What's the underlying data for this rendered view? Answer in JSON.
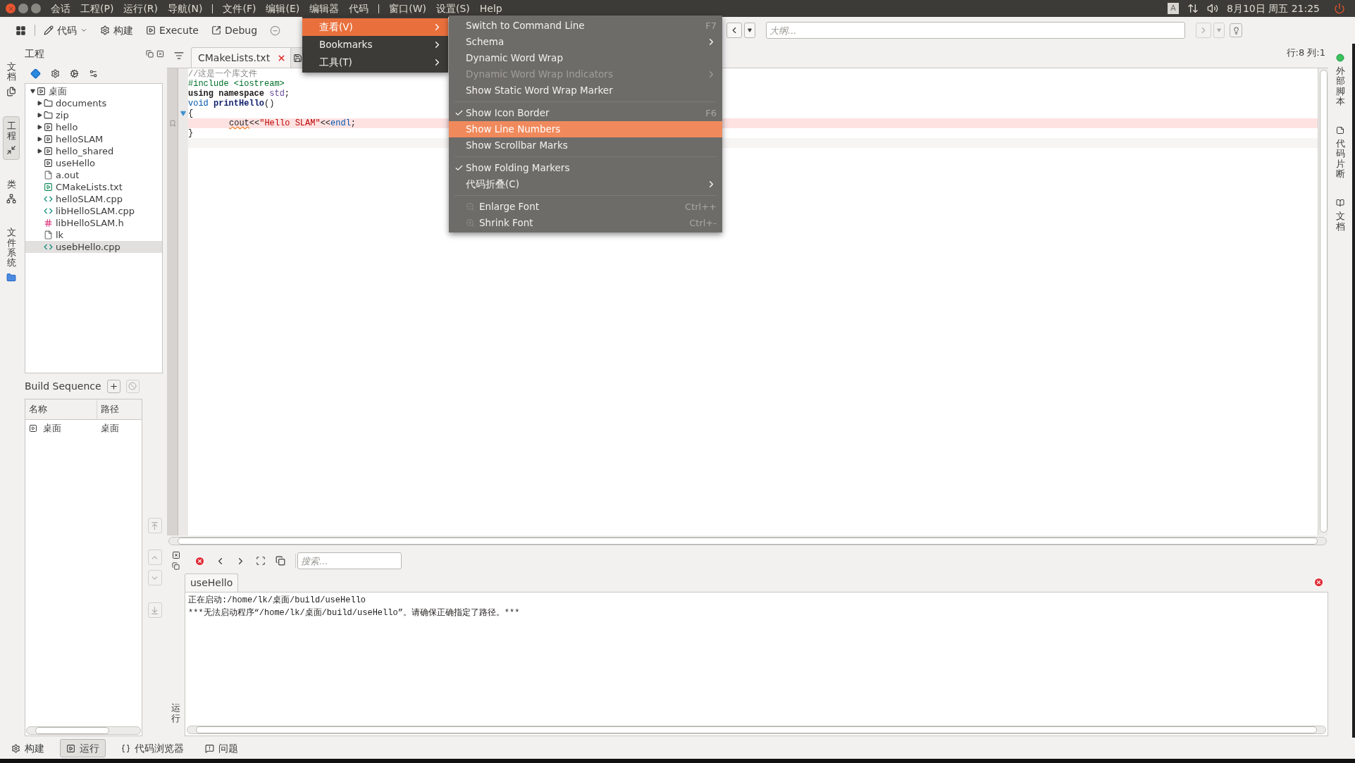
{
  "menubar": {
    "items": [
      {
        "kind": "menu",
        "label": "会话"
      },
      {
        "kind": "menu",
        "label": "工程(P)"
      },
      {
        "kind": "menu",
        "label": "运行(R)"
      },
      {
        "kind": "menu",
        "label": "导航(N)"
      },
      {
        "kind": "separator"
      },
      {
        "kind": "menu",
        "label": "文件(F)"
      },
      {
        "kind": "menu",
        "label": "编辑(E)"
      },
      {
        "kind": "menu",
        "label": "编辑器"
      },
      {
        "kind": "menu",
        "label": "代码"
      },
      {
        "kind": "separator"
      },
      {
        "kind": "menu",
        "label": "窗口(W)"
      },
      {
        "kind": "menu",
        "label": "设置(S)"
      },
      {
        "kind": "menu",
        "label": "Help"
      }
    ]
  },
  "tray": {
    "keyboard": "A",
    "clock": "8月10日 周五 21:25"
  },
  "toolbar": {
    "items": [
      {
        "label": "代码",
        "dropdown": true
      },
      {
        "label": "构建",
        "dropdown": false
      },
      {
        "label": "Execute",
        "dropdown": false
      },
      {
        "label": "Debug",
        "dropdown": false
      }
    ],
    "outline_placeholder": "大纲..."
  },
  "cursor_position": "行:8 列:1",
  "editor_tabs": [
    {
      "kind": "tab",
      "label": "CMakeLists.txt",
      "selected": true
    },
    {
      "kind": "covered",
      "selected": false
    }
  ],
  "code": [
    {
      "indented": false,
      "marked": false,
      "current": false,
      "fold_marker": false,
      "tokens": [
        {
          "kind": "comment",
          "text": "//这是一个库文件"
        }
      ]
    },
    {
      "indented": false,
      "marked": false,
      "current": false,
      "fold_marker": false,
      "tokens": [
        {
          "kind": "preprocessor",
          "text": "#include <iostream>"
        }
      ]
    },
    {
      "indented": false,
      "marked": false,
      "current": false,
      "fold_marker": false,
      "tokens": [
        {
          "kind": "keyword",
          "text": "using namespace"
        },
        {
          "kind": "namespace",
          "text": " std"
        },
        {
          "kind": "plain",
          "text": ";"
        }
      ]
    },
    {
      "indented": false,
      "marked": false,
      "current": false,
      "fold_marker": false,
      "tokens": [
        {
          "kind": "type",
          "text": "void "
        },
        {
          "kind": "function",
          "text": "printHello"
        },
        {
          "kind": "plain",
          "text": "()"
        }
      ]
    },
    {
      "indented": false,
      "marked": false,
      "current": false,
      "fold_marker": true,
      "tokens": [
        {
          "kind": "plain",
          "text": "{"
        }
      ]
    },
    {
      "indented": true,
      "marked": true,
      "current": false,
      "fold_marker": false,
      "tokens": [
        {
          "kind": "warning",
          "text": "cout"
        },
        {
          "kind": "plain",
          "text": "<<"
        },
        {
          "kind": "string",
          "text": "\"Hello SLAM\""
        },
        {
          "kind": "plain",
          "text": "<<"
        },
        {
          "kind": "type",
          "text": "endl"
        },
        {
          "kind": "plain",
          "text": ";"
        }
      ]
    },
    {
      "indented": false,
      "marked": false,
      "current": false,
      "fold_marker": false,
      "tokens": [
        {
          "kind": "plain",
          "text": "}"
        }
      ]
    },
    {
      "indented": false,
      "marked": false,
      "current": true,
      "fold_marker": false
    }
  ],
  "left_dock_tabs": [
    {
      "label": "文档",
      "selected": false
    },
    {
      "label": "工程",
      "selected": true
    },
    {
      "label": "类",
      "selected": false
    },
    {
      "label": "文件系统",
      "selected": false
    }
  ],
  "right_dock_tabs": [
    {
      "label": "外部脚本"
    },
    {
      "label": "代码片断"
    },
    {
      "label": "文档"
    }
  ],
  "project_panel": {
    "title": "工程",
    "tree": [
      {
        "label": "桌面",
        "kind": "target",
        "expanded": true,
        "selected": false,
        "children": [
          {
            "label": "documents",
            "kind": "folder",
            "expanded": false,
            "selected": false
          },
          {
            "label": "zip",
            "kind": "folder",
            "expanded": false,
            "selected": false
          },
          {
            "label": "hello",
            "kind": "target",
            "expanded": false,
            "selected": false
          },
          {
            "label": "helloSLAM",
            "kind": "target",
            "expanded": false,
            "selected": false
          },
          {
            "label": "hello_shared",
            "kind": "target",
            "expanded": false,
            "selected": false
          },
          {
            "label": "useHello",
            "kind": "target",
            "selected": false
          },
          {
            "label": "a.out",
            "kind": "unknown",
            "selected": false
          },
          {
            "label": "CMakeLists.txt",
            "kind": "cmake",
            "selected": false
          },
          {
            "label": "helloSLAM.cpp",
            "kind": "source",
            "selected": false
          },
          {
            "label": "libHelloSLAM.cpp",
            "kind": "source",
            "selected": false
          },
          {
            "label": "libHelloSLAM.h",
            "kind": "header",
            "selected": false
          },
          {
            "label": "lk",
            "kind": "unknown",
            "selected": false
          },
          {
            "label": "usebHello.cpp",
            "kind": "source",
            "selected": true
          }
        ]
      }
    ]
  },
  "build_sequence": {
    "title": "Build Sequence",
    "columns": [
      "名称",
      "路径"
    ],
    "rows": [
      [
        "桌面",
        "桌面"
      ]
    ]
  },
  "output_panel": {
    "dock_label": "运行",
    "search_placeholder": "搜索...",
    "tabs": [
      {
        "label": "useHello",
        "selected": true
      }
    ],
    "lines": [
      "正在启动:/home/lk/桌面/build/useHello",
      "***无法启动程序“/home/lk/桌面/build/useHello”。请确保正确指定了路径。***"
    ]
  },
  "status_tabs": [
    {
      "label": "构建",
      "selected": false
    },
    {
      "label": "运行",
      "selected": true
    },
    {
      "label": "代码浏览器",
      "selected": false
    },
    {
      "label": "问题",
      "selected": false
    }
  ],
  "open_menus": [
    {
      "items": [
        {
          "kind": "item",
          "label": "查看(V)",
          "submenu": true,
          "selected": true
        },
        {
          "kind": "item",
          "label": "Bookmarks",
          "submenu": true,
          "selected": false
        },
        {
          "kind": "item",
          "label": "工具(T)",
          "submenu": true,
          "selected": false
        }
      ]
    },
    {
      "items": [
        {
          "kind": "item",
          "label": "Switch to Command Line",
          "shortcut": "F7",
          "selected": false
        },
        {
          "kind": "item",
          "label": "Schema",
          "submenu": true,
          "selected": false
        },
        {
          "kind": "item",
          "label": "Dynamic Word Wrap",
          "checked": false,
          "selected": false
        },
        {
          "kind": "item",
          "label": "Dynamic Word Wrap Indicators",
          "submenu": true,
          "disabled": true,
          "selected": false
        },
        {
          "kind": "item",
          "label": "Show Static Word Wrap Marker",
          "checked": false,
          "selected": false
        },
        {
          "kind": "separator"
        },
        {
          "kind": "item",
          "label": "Show Icon Border",
          "shortcut": "F6",
          "checked": true,
          "selected": false
        },
        {
          "kind": "item",
          "label": "Show Line Numbers",
          "checked": false,
          "selected": true
        },
        {
          "kind": "item",
          "label": "Show Scrollbar Marks",
          "checked": false,
          "selected": false
        },
        {
          "kind": "separator"
        },
        {
          "kind": "item",
          "label": "Show Folding Markers",
          "checked": true,
          "selected": false
        },
        {
          "kind": "item",
          "label": "代码折叠(C)",
          "submenu": true,
          "selected": false
        },
        {
          "kind": "separator"
        },
        {
          "kind": "iconitem",
          "label": "Enlarge Font",
          "shortcut": "Ctrl++",
          "selected": false
        },
        {
          "kind": "iconitem",
          "label": "Shrink Font",
          "shortcut": "Ctrl+-",
          "selected": false
        }
      ]
    }
  ]
}
